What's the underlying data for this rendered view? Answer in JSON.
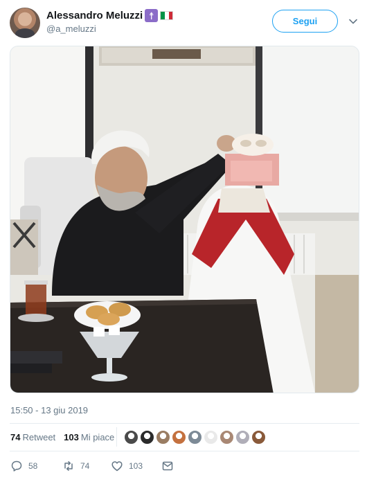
{
  "tweet": {
    "author": {
      "display_name": "Alessandro Meluzzi",
      "handle": "@a_meluzzi",
      "badges": [
        "cross-of-lorraine-emoji",
        "italy-flag-emoji"
      ]
    },
    "follow_label": "Segui",
    "more_icon": "chevron-down-icon",
    "timestamp": "15:50 - 13 giu 2019",
    "stats": {
      "retweets_count": "74",
      "retweets_label": "Retweet",
      "likes_count": "103",
      "likes_label": "Mi piace"
    },
    "liker_avatars": [
      {
        "color": "#4a4a4a"
      },
      {
        "color": "#2b2b2b"
      },
      {
        "color": "#9a7d63"
      },
      {
        "color": "#c4713f"
      },
      {
        "color": "#7d8a96"
      },
      {
        "color": "#e9e9e9"
      },
      {
        "color": "#a98874"
      },
      {
        "color": "#b0aeb8"
      },
      {
        "color": "#8a5a3a"
      }
    ],
    "actions": {
      "reply_count": "58",
      "retweet_count": "74",
      "like_count": "103",
      "reply_icon": "reply-icon",
      "retweet_icon": "retweet-icon",
      "like_icon": "heart-icon",
      "dm_icon": "envelope-icon"
    }
  },
  "colors": {
    "accent": "#1da1f2",
    "muted": "#657786",
    "text": "#14171a",
    "divider": "#e6ecf0"
  }
}
